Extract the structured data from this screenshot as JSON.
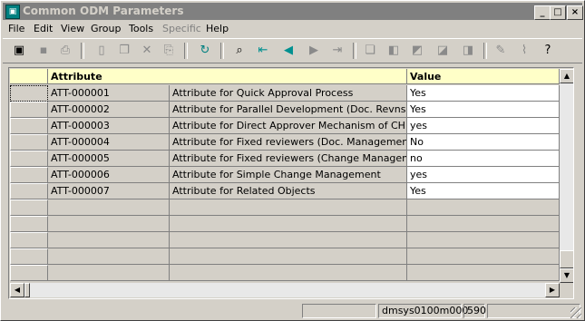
{
  "window": {
    "title": "Common ODM Parameters",
    "icon": "app-icon",
    "controls": [
      "_",
      "□",
      "×"
    ]
  },
  "menu": [
    "File",
    "Edit",
    "View",
    "Group",
    "Tools",
    "Specific",
    "Help"
  ],
  "menu_disabled": [
    "Specific"
  ],
  "toolbar": {
    "icons": [
      "save-exit-icon",
      "save-icon",
      "print-icon",
      "new-icon",
      "copy-icon",
      "delete-icon",
      "paste-icon",
      "refresh-icon",
      "find-icon",
      "first-icon",
      "previous-icon",
      "next-icon",
      "last-icon",
      "group-copy-icon",
      "group-first-icon",
      "group-previous-icon",
      "group-next-icon",
      "group-last-icon",
      "edit-icon",
      "attach-icon",
      "help-icon"
    ]
  },
  "grid": {
    "headers": {
      "attribute": "Attribute",
      "value": "Value"
    },
    "rows": [
      {
        "id": "ATT-000001",
        "description": "Attribute for Quick Approval Process",
        "value": "Yes"
      },
      {
        "id": "ATT-000002",
        "description": "Attribute for Parallel Development (Doc. Revns)",
        "value": "Yes"
      },
      {
        "id": "ATT-000003",
        "description": "Attribute for Direct Approver Mechanism of CHM",
        "value": "yes"
      },
      {
        "id": "ATT-000004",
        "description": "Attribute for Fixed reviewers (Doc. Management)",
        "value": "No"
      },
      {
        "id": "ATT-000005",
        "description": "Attribute for Fixed reviewers (Change Management)",
        "value": "no"
      },
      {
        "id": "ATT-000006",
        "description": "Attribute for Simple Change Management",
        "value": "yes"
      },
      {
        "id": "ATT-000007",
        "description": "Attribute for Related Objects",
        "value": "Yes"
      }
    ],
    "empty_rows": 6
  },
  "status": {
    "field1": "",
    "server": "dmsys0100m000",
    "company": "590",
    "field4": ""
  },
  "colors": {
    "header_bg": "#ffffc8",
    "title_inactive": "#808080",
    "face": "#d4d0c8"
  }
}
